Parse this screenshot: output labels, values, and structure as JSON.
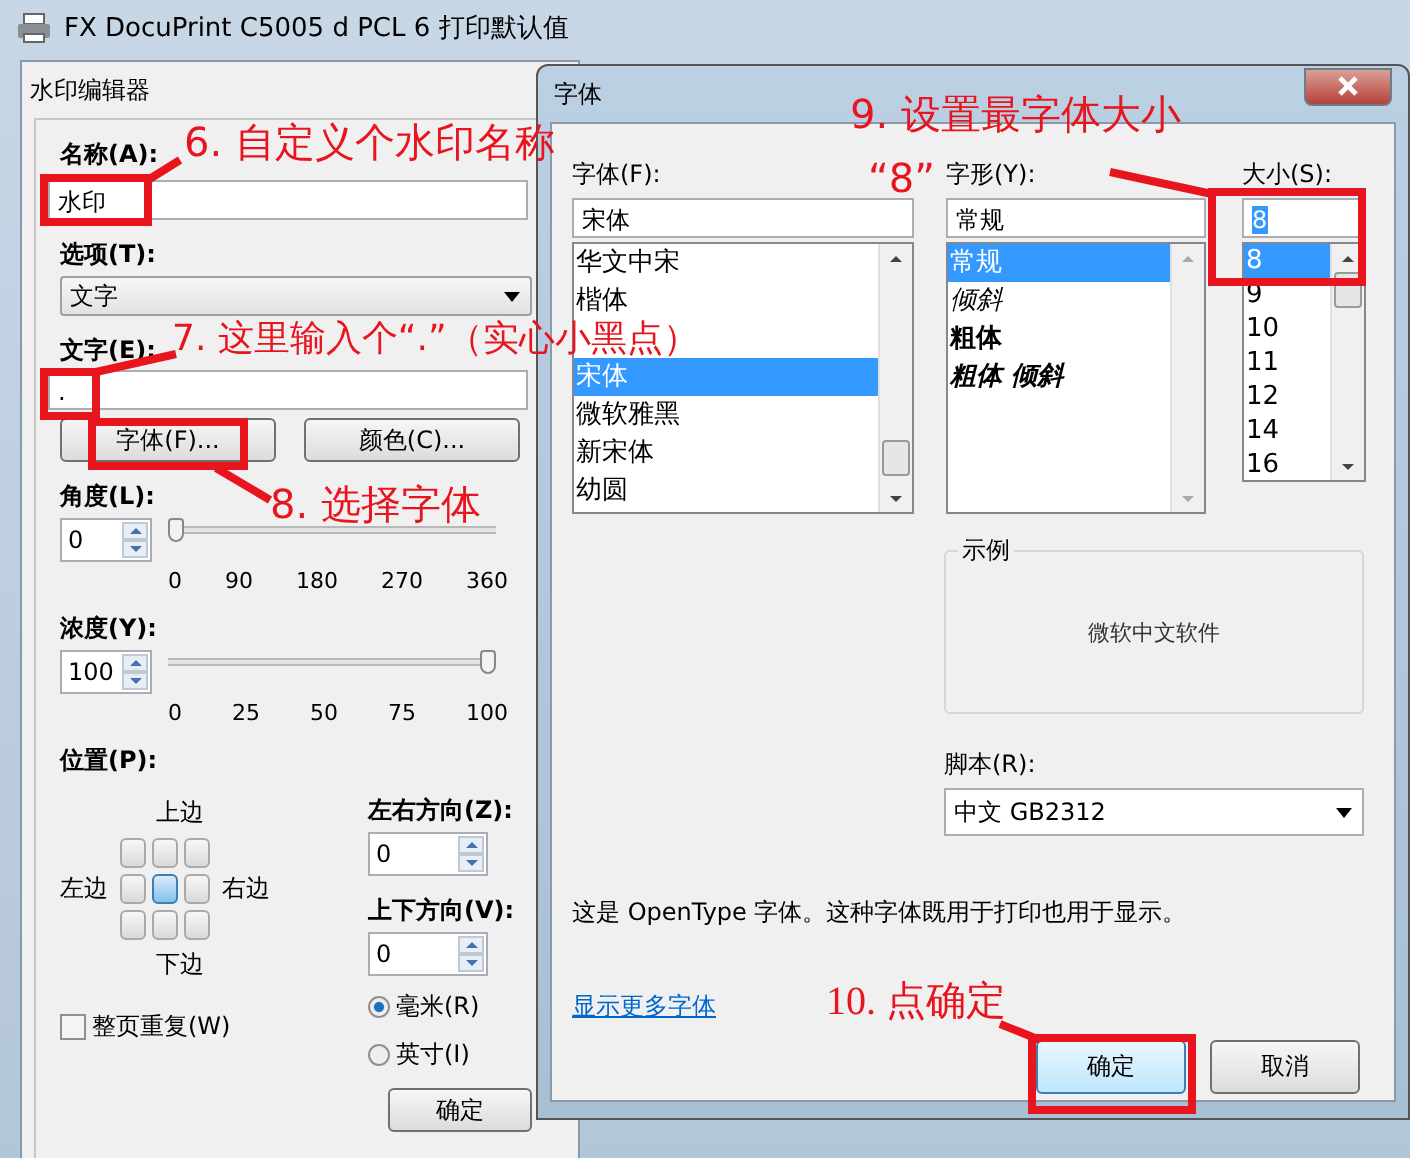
{
  "background_window": {
    "title": "FX DocuPrint C5005 d PCL 6 打印默认值"
  },
  "watermark_editor": {
    "title": "水印编辑器",
    "name_label": "名称(A):",
    "name_value": "水印",
    "option_label": "选项(T):",
    "option_value": "文字",
    "text_label": "文字(E):",
    "text_value": ".",
    "font_button": "字体(F)...",
    "color_button": "颜色(C)...",
    "angle": {
      "label": "角度(L):",
      "value": "0",
      "level": 0,
      "ticks": [
        "0",
        "90",
        "180",
        "270",
        "360"
      ]
    },
    "density": {
      "label": "浓度(Y):",
      "value": "100",
      "level": 1,
      "ticks": [
        "0",
        "25",
        "50",
        "75",
        "100"
      ]
    },
    "position": {
      "label": "位置(P):",
      "top": "上边",
      "left": "左边",
      "right": "右边",
      "bottom": "下边",
      "cells": [
        {
          "selected": false
        },
        {
          "selected": false
        },
        {
          "selected": false
        },
        {
          "selected": false
        },
        {
          "selected": true
        },
        {
          "selected": false
        },
        {
          "selected": false
        },
        {
          "selected": false
        },
        {
          "selected": false
        }
      ]
    },
    "horizontal": {
      "label": "左右方向(Z):",
      "value": "0"
    },
    "vertical": {
      "label": "上下方向(V):",
      "value": "0"
    },
    "units": [
      {
        "label": "毫米(R)",
        "selected": true
      },
      {
        "label": "英寸(I)",
        "selected": false
      }
    ],
    "repeat": {
      "label": "整页重复(W)",
      "checked": false
    },
    "ok_button": "确定"
  },
  "font_dialog": {
    "title": "字体",
    "font_label": "字体(F):",
    "font_value": "宋体",
    "fonts": [
      {
        "kind": "font",
        "label": "华文中宋",
        "selected": false
      },
      {
        "kind": "font",
        "label": "楷体",
        "selected": false
      },
      {
        "kind": "covered"
      },
      {
        "kind": "font",
        "label": "宋体",
        "selected": true
      },
      {
        "kind": "font",
        "label": "微软雅黑",
        "selected": false
      },
      {
        "kind": "font",
        "label": "新宋体",
        "selected": false
      },
      {
        "kind": "font",
        "label": "幼圆",
        "selected": false
      }
    ],
    "style_label": "字形(Y):",
    "style_value": "常规",
    "styles": [
      {
        "label": "常规",
        "kind": "regular",
        "selected": true
      },
      {
        "label": "倾斜",
        "kind": "italic",
        "selected": false
      },
      {
        "label": "粗体",
        "kind": "bold",
        "selected": false
      },
      {
        "label": "粗体 倾斜",
        "kind": "bold-italic",
        "selected": false
      }
    ],
    "size_label": "大小(S):",
    "size_value": "8",
    "sizes": [
      {
        "label": "8",
        "selected": true
      },
      {
        "label": "9",
        "selected": false
      },
      {
        "label": "10",
        "selected": false
      },
      {
        "label": "11",
        "selected": false
      },
      {
        "label": "12",
        "selected": false
      },
      {
        "label": "14",
        "selected": false
      },
      {
        "label": "16",
        "selected": false
      }
    ],
    "sample_label": "示例",
    "sample_text": "微软中文软件",
    "script_label": "脚本(R):",
    "script_value": "中文 GB2312",
    "note": "这是 OpenType 字体。这种字体既用于打印也用于显示。",
    "more_fonts_link": "显示更多字体",
    "ok_button": "确定",
    "cancel_button": "取消"
  },
  "annotations": [
    {
      "text": "6. 自定义个水印名称"
    },
    {
      "text": "7. 这里输入个“.”（实心小黑点）"
    },
    {
      "text": "8. 选择字体"
    },
    {
      "text": "9. 设置最字体大小"
    },
    {
      "text": "“8”"
    },
    {
      "text": "10. 点确定"
    }
  ]
}
